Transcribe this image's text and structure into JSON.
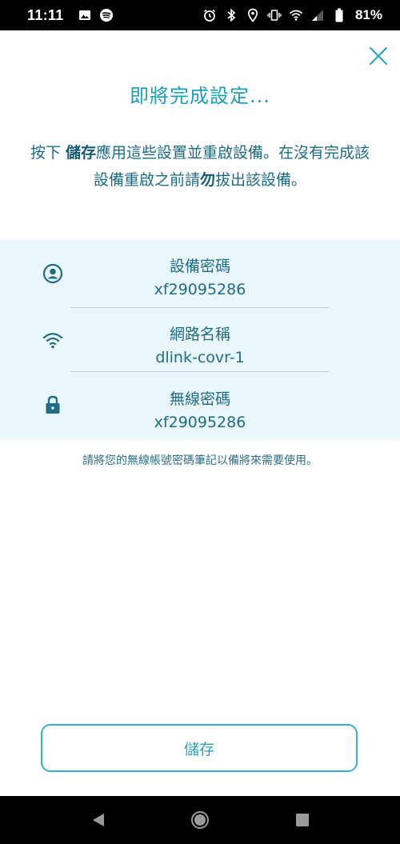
{
  "status_bar": {
    "time": "11:11",
    "battery_percent": "81%",
    "left_icons": [
      "image-icon",
      "spotify-icon"
    ],
    "right_icons": [
      "alarm-icon",
      "bluetooth-icon",
      "location-icon",
      "vibrate-icon",
      "wifi-icon",
      "signal-icon",
      "battery-icon"
    ]
  },
  "header": {
    "title": "即將完成設定...",
    "description_prefix": "按下 ",
    "description_bold": "儲存",
    "description_mid": "應用這些設置並重啟設備。在沒有完成該設備重啟之前請",
    "description_bold2": "勿",
    "description_suffix": "拔出該設備。"
  },
  "info": {
    "rows": [
      {
        "icon": "user-icon",
        "label": "設備密碼",
        "value": "xf29095286"
      },
      {
        "icon": "wifi-icon",
        "label": "網路名稱",
        "value": "dlink-covr-1"
      },
      {
        "icon": "lock-icon",
        "label": "無線密碼",
        "value": "xf29095286"
      }
    ]
  },
  "note": "請將您的無線帳號密碼筆記以備將來需要使用。",
  "actions": {
    "save_label": "儲存"
  },
  "colors": {
    "accent": "#1a9fb8",
    "text": "#1f6c84",
    "panel_bg": "#e9f6fa",
    "button_border": "#35aecb"
  }
}
